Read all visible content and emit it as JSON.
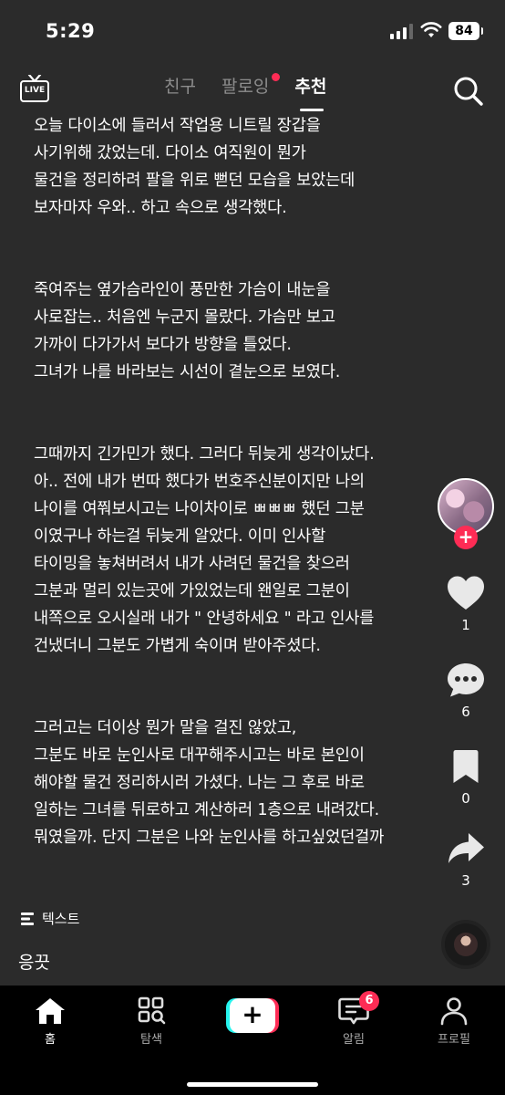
{
  "status_bar": {
    "time": "5:29",
    "battery": "84"
  },
  "top_nav": {
    "live_label": "LIVE",
    "tabs": [
      {
        "label": "친구",
        "active": false
      },
      {
        "label": "팔로잉",
        "active": false,
        "has_dot": true
      },
      {
        "label": "추천",
        "active": true
      }
    ]
  },
  "caption": {
    "paragraphs": [
      "오늘 다이소에 들러서 작업용 니트릴 장갑을\n사기위해 갔었는데. 다이소 여직원이 뭔가\n물건을 정리하려 팔을 위로 뻗던 모습을 보았는데\n보자마자 우와.. 하고 속으로 생각했다.",
      "죽여주는 옆가슴라인이 풍만한 가슴이 내눈을\n사로잡는.. 처음엔 누군지 몰랐다. 가슴만 보고\n가까이 다가가서 보다가 방향을 틀었다.\n그녀가 나를 바라보는 시선이 곁눈으로 보였다.",
      "그때까지 긴가민가 했다. 그러다 뒤늦게 생각이났다.\n아.. 전에 내가 번따 했다가 번호주신분이지만 나의\n나이를 여쭤보시고는 나이차이로 ㅃㅃㅃ 했던 그분\n이였구나 하는걸 뒤늦게 알았다. 이미 인사할\n타이밍을 놓쳐버려서 내가 사려던 물건을 찾으러\n그분과 멀리 있는곳에 가있었는데 왠일로 그분이\n내쪽으로 오시실래 내가 \" 안녕하세요 \" 라고 인사를\n건냈더니 그분도 가볍게 숙이며 받아주셨다.",
      "그러고는 더이상 뭔가 말을 걸진 않았고,\n그분도 바로 눈인사로 대꾸해주시고는 바로 본인이\n해야할 물건 정리하시러 가셨다. 나는 그 후로 바로\n일하는 그녀를 뒤로하고 계산하러 1층으로 내려갔다.\n뭐였을까. 단지 그분은 나와 눈인사를 하고싶었던걸까"
    ]
  },
  "actions": {
    "follow": "+",
    "likes": "1",
    "comments": "6",
    "bookmarks": "0",
    "shares": "3"
  },
  "post": {
    "text_tag": "텍스트",
    "username": "응끗"
  },
  "bottom_nav": {
    "items": [
      {
        "label": "홈",
        "icon": "home-icon",
        "active": true
      },
      {
        "label": "탐색",
        "icon": "explore-icon",
        "active": false
      },
      {
        "label": "",
        "icon": "create-icon",
        "active": false
      },
      {
        "label": "알림",
        "icon": "inbox-icon",
        "active": false,
        "badge": "6"
      },
      {
        "label": "프로필",
        "icon": "profile-icon",
        "active": false
      }
    ]
  },
  "colors": {
    "background": "#2b2b2b",
    "accent": "#fe2c55",
    "cyan": "#25f4ee"
  }
}
